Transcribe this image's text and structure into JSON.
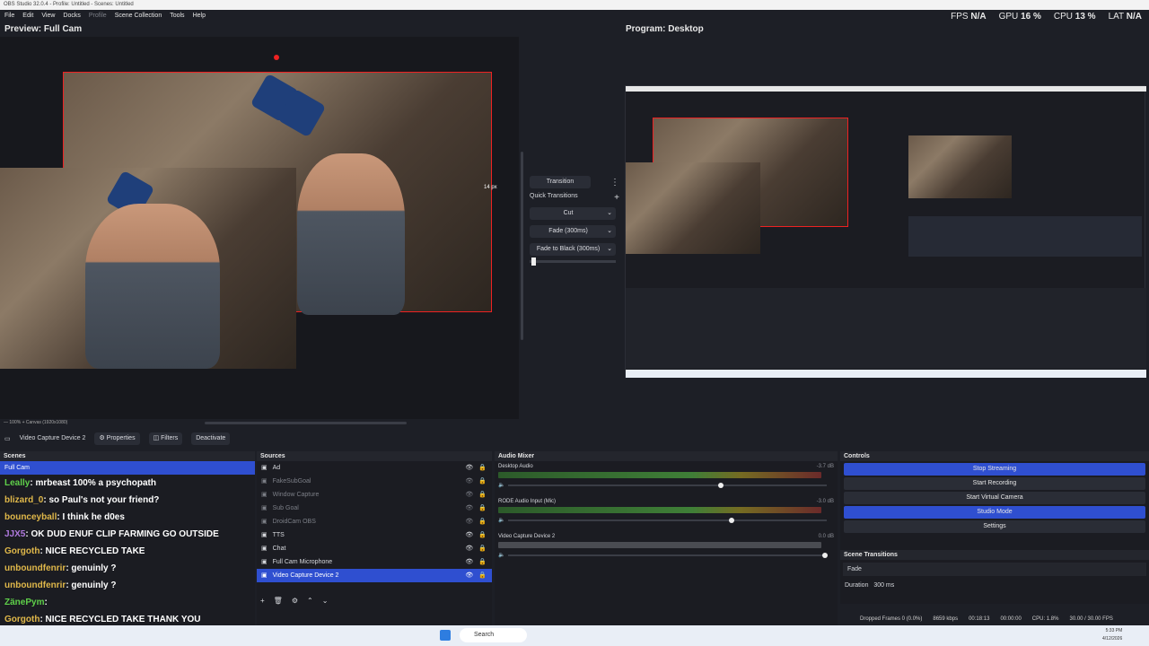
{
  "window": {
    "title": "OBS Studio 32.0.4 - Profile: Untitled - Scenes: Untitled"
  },
  "menu": [
    "File",
    "Edit",
    "View",
    "Docks",
    "Profile",
    "Scene Collection",
    "Tools",
    "Help"
  ],
  "stats": {
    "fps_label": "FPS",
    "fps": "N/A",
    "gpu_label": "GPU",
    "gpu": "16 %",
    "cpu_label": "CPU",
    "cpu": "13 %",
    "lat_label": "LAT",
    "lat": "N/A"
  },
  "preview": {
    "title": "Preview: Full Cam",
    "px_label": "14 px",
    "zoom": "100%",
    "canvas": "Canvas (1920x1080)"
  },
  "program": {
    "title": "Program: Desktop"
  },
  "transitions": {
    "transition_label": "Transition",
    "quick_label": "Quick Transitions",
    "items": [
      "Cut",
      "Fade (300ms)",
      "Fade to Black (300ms)"
    ]
  },
  "source_toolbar": {
    "source": "Video Capture Device 2",
    "properties": "Properties",
    "filters": "Filters",
    "deactivate": "Deactivate"
  },
  "scenes": {
    "title": "Scenes",
    "items": [
      "Full Cam"
    ]
  },
  "chat": [
    {
      "user": "Leally",
      "msg": ": mrbeast 100% a psychopath",
      "color": "#5fd04a"
    },
    {
      "user": "blizard_0",
      "msg": ": so Paul's not your friend?",
      "color": "#e0b84a"
    },
    {
      "user": "bounceyball",
      "msg": ": I think he d0es",
      "color": "#e0b84a"
    },
    {
      "user": "JJX5",
      "msg": ": OK DUD ENUF CLIP FARMING GO OUTSIDE",
      "color": "#b07adf"
    },
    {
      "user": "Gorgoth",
      "msg": ": NICE RECYCLED TAKE",
      "color": "#e0b84a"
    },
    {
      "user": "unboundfenrir",
      "msg": ": genuinly ?",
      "color": "#e0b84a"
    },
    {
      "user": "unboundfenrir",
      "msg": ": genuinly ?",
      "color": "#e0b84a"
    },
    {
      "user": "ZänePym",
      "msg": ":",
      "color": "#5fd04a"
    },
    {
      "user": "Gorgoth",
      "msg": ": NICE RECYCLED TAKE THANK YOU",
      "color": "#e0b84a"
    }
  ],
  "sources": {
    "title": "Sources",
    "items": [
      "Ad",
      "FakeSubGoal",
      "Window Capture",
      "Sub Goal",
      "DroidCam OBS",
      "TTS",
      "Chat",
      "Full Cam Microphone",
      "Video Capture Device 2"
    ]
  },
  "mixer": {
    "title": "Audio Mixer",
    "channels": [
      {
        "name": "Desktop Audio",
        "db": "-3.7 dB",
        "level": 0.78
      },
      {
        "name": "RODE Audio Input (Mic)",
        "db": "-3.0 dB",
        "level": 0.82
      },
      {
        "name": "Video Capture Device 2",
        "db": "0.0 dB",
        "level": 0.0
      }
    ]
  },
  "controls": {
    "title": "Controls",
    "buttons": [
      "Stop Streaming",
      "Start Recording",
      "Start Virtual Camera",
      "Studio Mode",
      "Settings"
    ]
  },
  "scene_transitions": {
    "title": "Scene Transitions",
    "value": "Fade",
    "duration_label": "Duration",
    "duration": "300 ms"
  },
  "statusbar": {
    "dropped": "Dropped Frames 0 (0.0%)",
    "bitrate": "8659 kbps",
    "stream_time": "00:18:13",
    "rec_time": "00:00:00",
    "cpu": "CPU: 1.8%",
    "fps": "30.00 / 30.00 FPS"
  },
  "taskbar": {
    "search": "Search",
    "time": "5:33 PM",
    "date": "4/12/2026"
  },
  "colors": {
    "accent": "#2f4fd0",
    "bg": "#1d1f26",
    "panel": "#24262d"
  }
}
